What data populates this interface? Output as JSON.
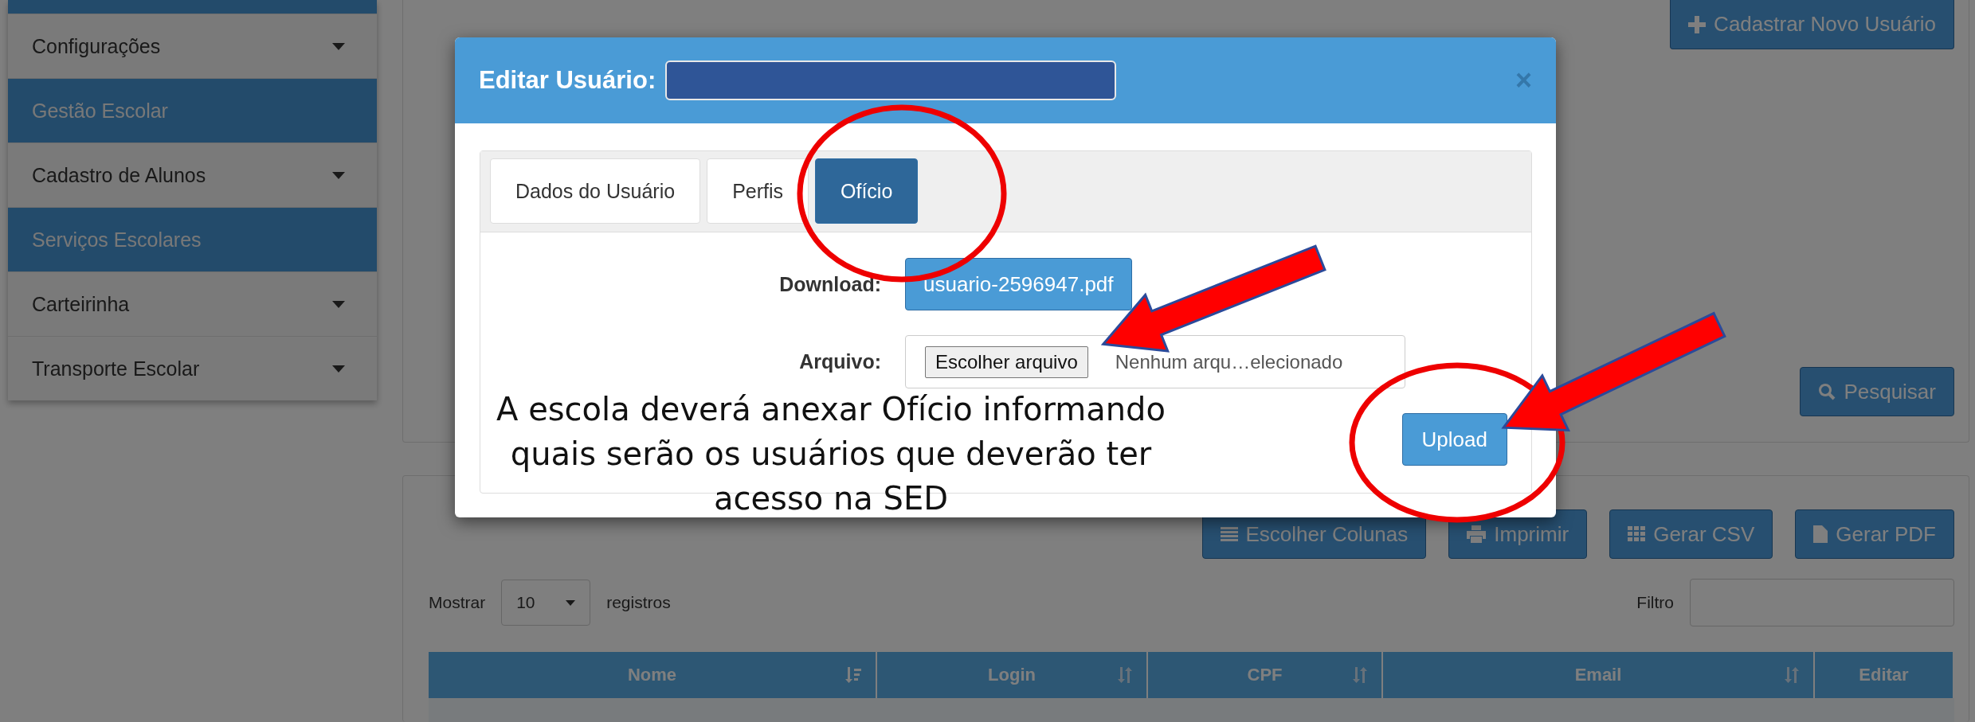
{
  "sidebar": {
    "items": [
      {
        "label": "Configurações",
        "kind": "dropdown"
      },
      {
        "label": "Gestão Escolar",
        "kind": "header"
      },
      {
        "label": "Cadastro de Alunos",
        "kind": "dropdown"
      },
      {
        "label": "Serviços Escolares",
        "kind": "header"
      },
      {
        "label": "Carteirinha",
        "kind": "dropdown"
      },
      {
        "label": "Transporte Escolar",
        "kind": "dropdown"
      }
    ]
  },
  "search_panel": {
    "new_user_button": "Cadastrar Novo Usuário",
    "search_button": "Pesquisar"
  },
  "results_panel": {
    "toolbar": [
      {
        "label": "Escolher Colunas",
        "kind": "columns"
      },
      {
        "label": "Imprimir",
        "kind": "print"
      },
      {
        "label": "Gerar CSV",
        "kind": "csv"
      },
      {
        "label": "Gerar PDF",
        "kind": "pdf"
      }
    ],
    "show_label": "Mostrar",
    "page_size": "10",
    "show_suffix": "registros",
    "filter_label": "Filtro",
    "table": {
      "columns": [
        {
          "label": "Nome",
          "kind": "sorted"
        },
        {
          "label": "Login",
          "kind": "sortable"
        },
        {
          "label": "CPF",
          "kind": "sortable"
        },
        {
          "label": "Email",
          "kind": "sortable"
        },
        {
          "label": "Editar",
          "kind": "plain"
        }
      ]
    }
  },
  "modal": {
    "title": "Editar Usuário:",
    "close": "×",
    "tabs": [
      {
        "label": "Dados do Usuário",
        "selected": false
      },
      {
        "label": "Perfis",
        "selected": false
      },
      {
        "label": "Ofício",
        "selected": true
      }
    ],
    "download_label": "Download:",
    "download_file": "usuario-2596947.pdf",
    "file_label": "Arquivo:",
    "file_button": "Escolher arquivo",
    "file_status": "Nenhum arqu…elecionado",
    "upload_button": "Upload"
  },
  "annotation": {
    "caption_lines": [
      "A escola deverá anexar Ofício informando",
      "quais serão os usuários que deverão ter",
      "acesso na SED"
    ]
  }
}
